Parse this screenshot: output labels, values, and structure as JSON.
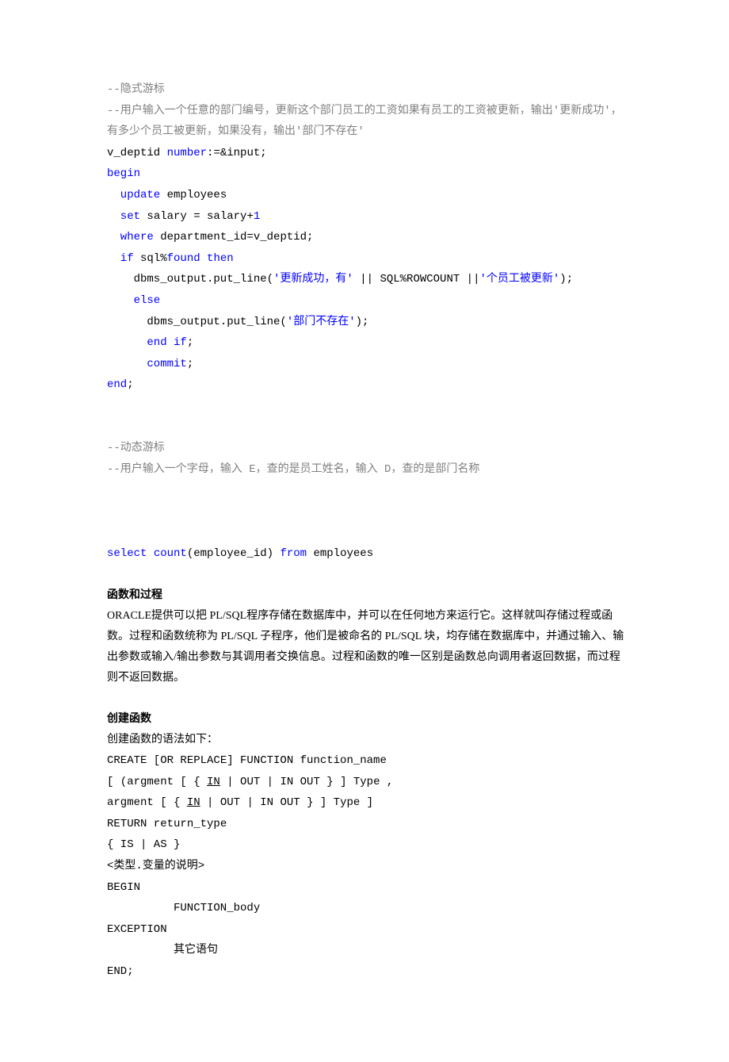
{
  "code1": {
    "l1": "--隐式游标",
    "l2": "--用户输入一个任意的部门编号，更新这个部门员工的工资如果有员工的工资被更新，输出'更新成功'，有多少个员工被更新，如果没有，输出'部门不存在'",
    "l3a": "v_deptid ",
    "l3b": "number",
    "l3c": ":=&input;",
    "l4": "begin",
    "l5a": "update",
    "l5b": " employees",
    "l6a": "set",
    "l6b": " salary = salary+",
    "l6c": "1",
    "l7a": "where",
    "l7b": " department_id=v_deptid;",
    "l8a": "if",
    "l8b": " sql%",
    "l8c": "found",
    "l8d": " then",
    "l9a": "dbms_output.put_line(",
    "l9b": "'更新成功，有'",
    "l9c": " || SQL%ROWCOUNT ||",
    "l9d": "'个员工被更新'",
    "l9e": ");",
    "l10": "else",
    "l11a": "dbms_output.put_line(",
    "l11b": "'部门不存在'",
    "l11c": ");",
    "l12a": "end",
    "l12b": " if",
    "l12c": ";",
    "l13": "commit",
    "l13b": ";",
    "l14": "end",
    "l14b": ";"
  },
  "code2": {
    "l1": "--动态游标",
    "l2": "--用户输入一个字母，输入 E，查的是员工姓名，输入 D，查的是部门名称"
  },
  "code3": {
    "l1a": "select",
    "l1b": " count",
    "l1c": "(employee_id) ",
    "l1d": "from",
    "l1e": " employees"
  },
  "section1": {
    "heading": "函数和过程",
    "p1": "ORACLE提供可以把 PL/SQL程序存储在数据库中，并可以在任何地方来运行它。这样就叫存储过程或函数。过程和函数统称为 PL/SQL 子程序，他们是被命名的 PL/SQL 块，均存储在数据库中，并通过输入、输出参数或输入/输出参数与其调用者交换信息。过程和函数的唯一区别是函数总向调用者返回数据，而过程则不返回数据。"
  },
  "section2": {
    "heading": "创建函数",
    "intro": "创建函数的语法如下：",
    "l1": "CREATE [OR REPLACE] FUNCTION function_name",
    "l2a": "[ (argment [ { ",
    "l2b": "IN",
    "l2c": " | OUT | IN OUT } ] Type ,",
    "l3a": "   argment [ { ",
    "l3b": "IN",
    "l3c": " | OUT | IN OUT } ] Type ]",
    "l4": "RETURN return_type",
    "l5": "{ IS | AS }",
    "l6": "<类型.变量的说明>",
    "l7": "BEGIN",
    "l8": "FUNCTION_body",
    "l9": "EXCEPTION",
    "l10": "其它语句",
    "l11": "END;"
  }
}
